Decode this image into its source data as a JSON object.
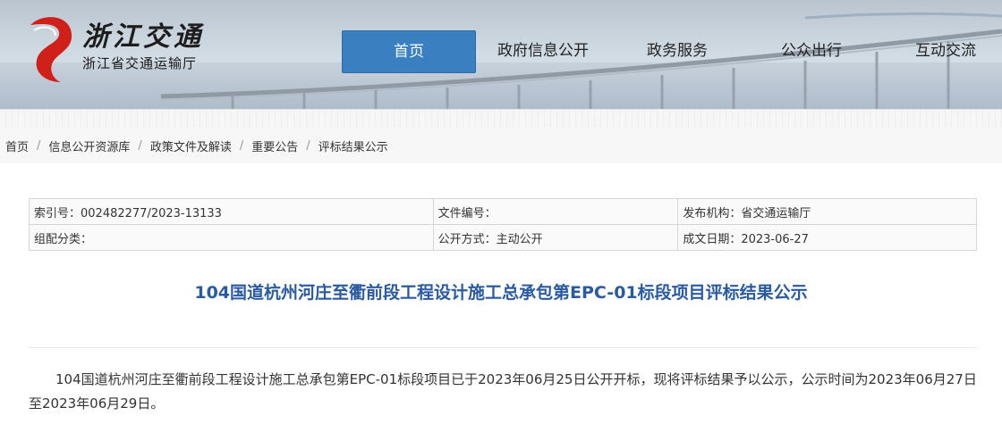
{
  "site": {
    "logo_title": "浙江交通",
    "logo_subtitle": "浙江省交通运输厅"
  },
  "nav": {
    "items": [
      {
        "label": "首页",
        "active": true
      },
      {
        "label": "政府信息公开",
        "active": false
      },
      {
        "label": "政务服务",
        "active": false
      },
      {
        "label": "公众出行",
        "active": false
      },
      {
        "label": "互动交流",
        "active": false
      }
    ]
  },
  "breadcrumb": {
    "items": [
      "首页",
      "信息公开资源库",
      "政策文件及解读",
      "重要公告",
      "评标结果公示"
    ],
    "separator": "/"
  },
  "meta": {
    "index_no": "索引号：002482277/2023-13133",
    "doc_no": "文件编号：",
    "publisher": "发布机构：省交通运输厅",
    "category": "组配分类：",
    "open_mode": "公开方式：主动公开",
    "date": "成文日期：2023-06-27"
  },
  "article": {
    "title": "104国道杭州河庄至衢前段工程设计施工总承包第EPC-01标段项目评标结果公示",
    "paragraph": "104国道杭州河庄至衢前段工程设计施工总承包第EPC-01标段项目已于2023年06月25日公开开标，现将评标结果予以公示，公示时间为2023年06月27日至2023年06月29日。"
  },
  "colors": {
    "nav_active": "#3a7fc0",
    "title_blue": "#2a5aa0",
    "logo_red": "#d0201a"
  }
}
